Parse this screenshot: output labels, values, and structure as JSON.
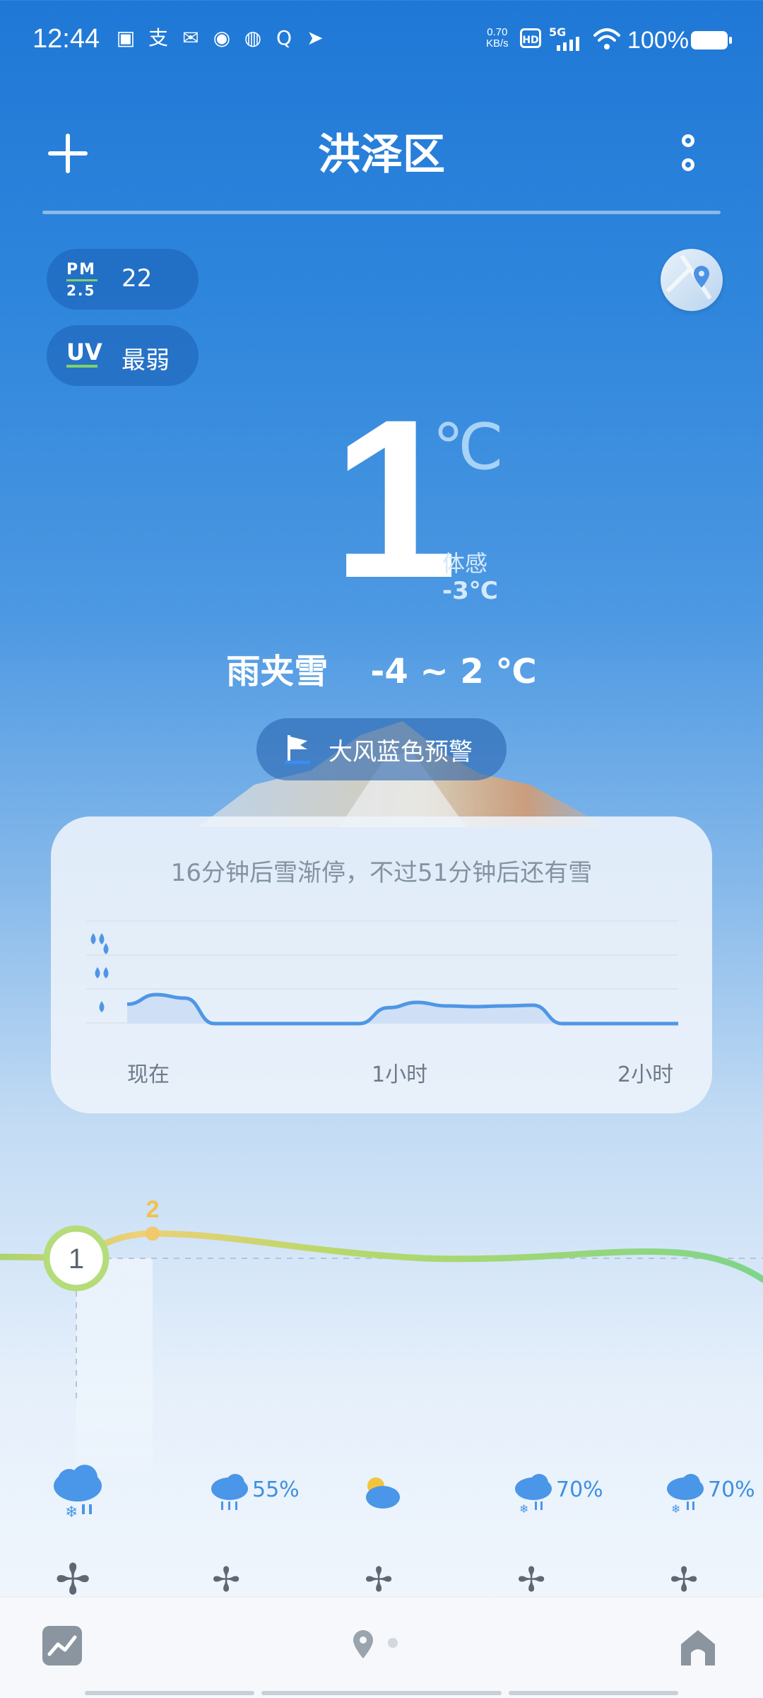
{
  "status_bar": {
    "time": "12:44",
    "notification_icons": [
      "clipboard-check-icon",
      "alipay-icon",
      "mail-icon",
      "weibo-icon",
      "wechat-icon",
      "qq-icon",
      "telegram-icon"
    ],
    "net_speed_value": "0.70",
    "net_speed_unit": "KB/s",
    "hd_label": "HD",
    "network_type": "5G",
    "battery": "100%"
  },
  "header": {
    "city": "洪泽区"
  },
  "air": {
    "pm_label_top": "PM",
    "pm_label_bottom": "2.5",
    "pm_value": "22",
    "uv_label": "UV",
    "uv_value": "最弱"
  },
  "current": {
    "temp": "1",
    "unit": "℃",
    "feels_label": "体感",
    "feels_value": "-3℃",
    "condition": "雨夹雪",
    "range": "-4 ~ 2 ℃"
  },
  "warning": {
    "text": "大风蓝色预警",
    "color": "#1e6fd0"
  },
  "precip": {
    "summary": "16分钟后雪渐停，不过51分钟后还有雪",
    "axis_labels": [
      "现在",
      "1小时",
      "2小时"
    ],
    "intensity_levels": [
      "light",
      "moderate",
      "heavy"
    ],
    "curve": [
      0.55,
      0.82,
      0.72,
      0.0,
      0.0,
      0.0,
      0.0,
      0.0,
      0.0,
      0.45,
      0.6,
      0.5,
      0.48,
      0.5,
      0.52,
      0.0,
      0.0,
      0.0,
      0.0,
      0.0
    ],
    "line_color": "#4f96e6"
  },
  "forecast": {
    "current_temp": "1",
    "high_marker": "2",
    "hours": [
      {
        "icon": "sleet-cloud-icon",
        "pct": ""
      },
      {
        "icon": "rain-cloud-icon",
        "pct": "55%"
      },
      {
        "icon": "partly-cloudy-icon",
        "pct": ""
      },
      {
        "icon": "sleet-cloud-icon",
        "pct": "70%"
      },
      {
        "icon": "sleet-cloud-icon",
        "pct": "70%"
      }
    ]
  }
}
